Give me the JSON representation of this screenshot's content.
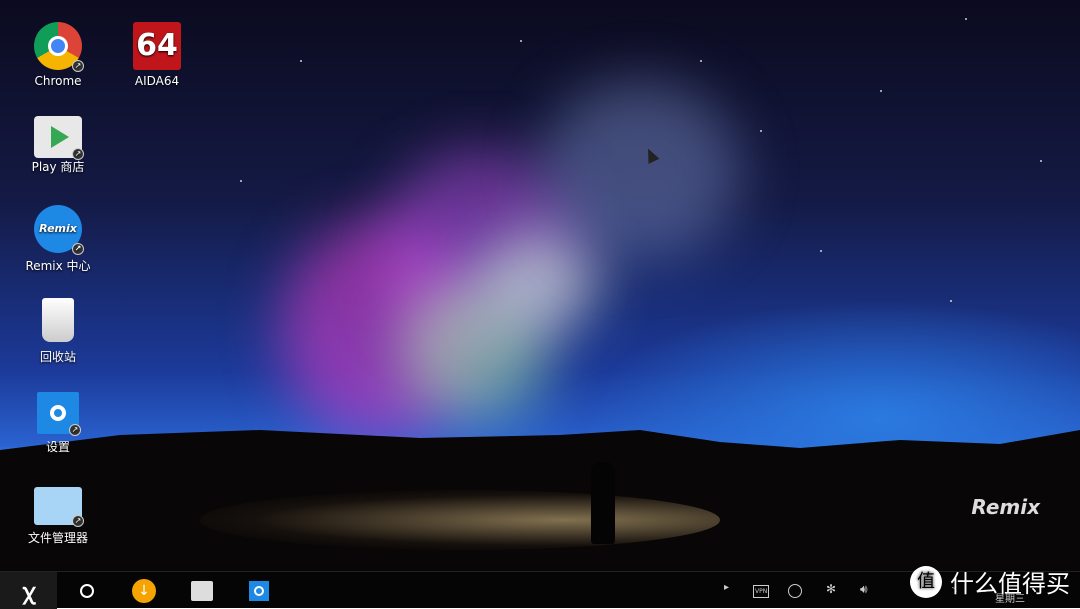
{
  "desktop": {
    "icons": [
      {
        "label": "Chrome",
        "icon": "chrome-icon"
      },
      {
        "label": "AIDA64",
        "icon": "aida64-icon",
        "glyph": "64"
      },
      {
        "label": "Play 商店",
        "icon": "play-store-icon"
      },
      {
        "label": "Remix 中心",
        "icon": "remix-center-icon",
        "glyph": "Remix"
      },
      {
        "label": "回收站",
        "icon": "recycle-bin-icon"
      },
      {
        "label": "设置",
        "icon": "settings-icon"
      },
      {
        "label": "文件管理器",
        "icon": "file-manager-icon"
      }
    ],
    "brand_mark": "Remix"
  },
  "taskbar": {
    "start_glyph": "ꭓ",
    "tray": {
      "arrow": "▸",
      "vpn": "VPN",
      "bt": "✻",
      "vol": "🔊︎",
      "day": "星期三"
    }
  },
  "watermark": {
    "text": "什么值得买",
    "badge": "值"
  },
  "colors": {
    "aida": "#c0161b",
    "remix": "#1e88e5",
    "download": "#f5a300",
    "settings": "#1e88e5"
  }
}
